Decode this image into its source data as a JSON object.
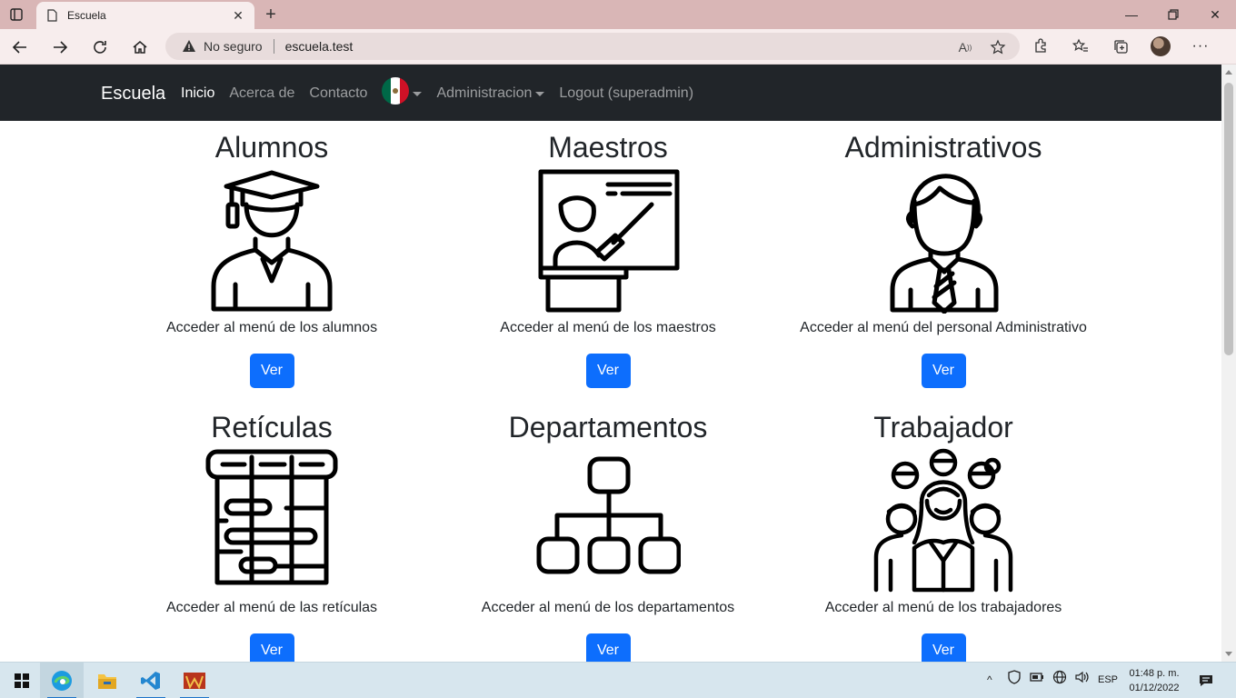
{
  "browser": {
    "tab_title": "Escuela",
    "address_security": "No seguro",
    "address_url": "escuela.test",
    "colors": {
      "titlebar": "#d9b6b6",
      "toolbar": "#f7eded"
    }
  },
  "navbar": {
    "brand": "Escuela",
    "links": {
      "inicio": "Inicio",
      "acerca": "Acerca de",
      "contacto": "Contacto",
      "administracion": "Administracion",
      "logout": "Logout (superadmin)"
    },
    "language_flag": "mexico-flag-icon",
    "colors": {
      "background": "#212529",
      "active": "#ffffff",
      "inactive": "rgba(255,255,255,0.55)"
    }
  },
  "cards": [
    {
      "title": "Alumnos",
      "icon": "graduate-student-icon",
      "description": "Acceder al menú de los alumnos",
      "button": "Ver"
    },
    {
      "title": "Maestros",
      "icon": "teacher-board-icon",
      "description": "Acceder al menú de los maestros",
      "button": "Ver"
    },
    {
      "title": "Administrativos",
      "icon": "office-worker-icon",
      "description": "Acceder al menú del personal Administrativo",
      "button": "Ver"
    },
    {
      "title": "Retículas",
      "icon": "grid-schedule-icon",
      "description": "Acceder al menú de las retículas",
      "button": "Ver"
    },
    {
      "title": "Departamentos",
      "icon": "org-chart-icon",
      "description": "Acceder al menú de los departamentos",
      "button": "Ver"
    },
    {
      "title": "Trabajador",
      "icon": "group-of-workers-icon",
      "description": "Acceder al menú de los trabajadores",
      "button": "Ver"
    }
  ],
  "accent_color": "#0d6efd",
  "taskbar": {
    "language": "ESP",
    "time": "01:48 p. m.",
    "date": "01/12/2022",
    "apps": [
      "edge-icon",
      "file-explorer-icon",
      "vscode-icon",
      "wamp-icon"
    ]
  }
}
